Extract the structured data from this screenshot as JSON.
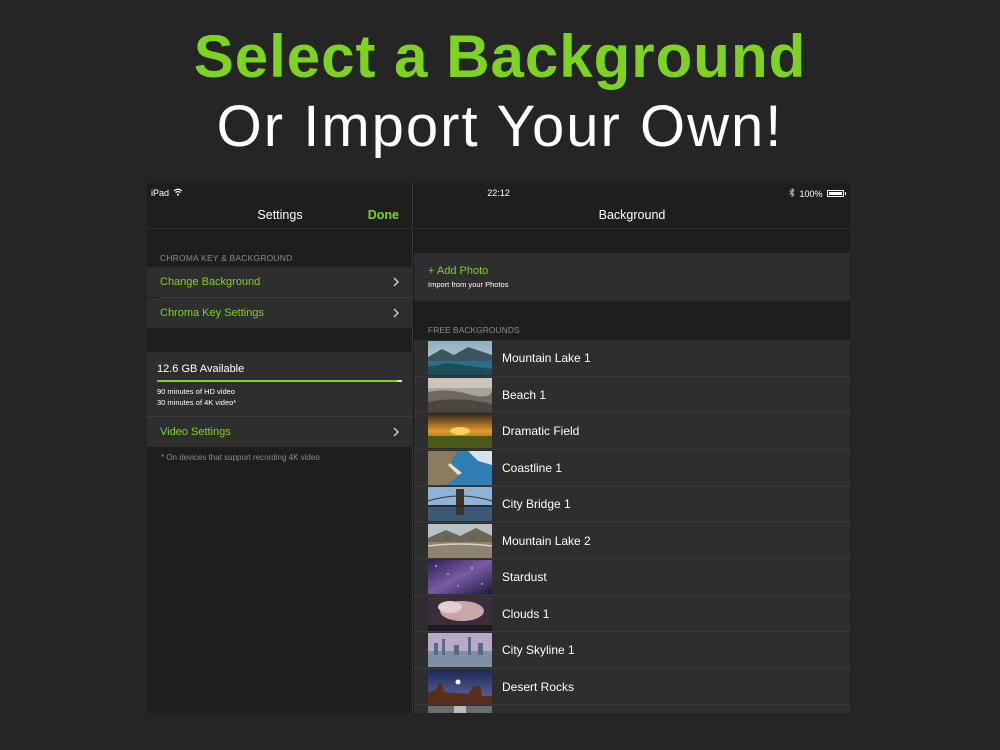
{
  "promo": {
    "headline": "Select a Background",
    "subheadline": "Or Import Your Own!"
  },
  "colors": {
    "accent": "#7ed321",
    "background": "#252525",
    "cell": "#2e2e2e"
  },
  "status_bar": {
    "device": "iPad",
    "wifi_icon": "wifi-icon",
    "time": "22:12",
    "bluetooth_icon": "bluetooth-icon",
    "battery": "100%"
  },
  "settings": {
    "title": "Settings",
    "done_label": "Done",
    "section_header": "CHROMA KEY & BACKGROUND",
    "change_background": "Change Background",
    "chroma_key_settings": "Chroma Key Settings",
    "storage": {
      "available": "12.6 GB Available",
      "used_fraction": 0.98,
      "hd_minutes": "90 minutes of HD video",
      "k4_minutes": "30 minutes of 4K video*"
    },
    "video_settings": "Video Settings",
    "footnote": "* On devices that support recording 4K video"
  },
  "background": {
    "title": "Background",
    "add_photo": "+ Add Photo",
    "add_photo_sub": "Import from your Photos",
    "section_header": "FREE BACKGROUNDS",
    "items": [
      {
        "name": "Mountain Lake 1",
        "thumb": "lake"
      },
      {
        "name": "Beach 1",
        "thumb": "beach"
      },
      {
        "name": "Dramatic Field",
        "thumb": "field"
      },
      {
        "name": "Coastline 1",
        "thumb": "coast"
      },
      {
        "name": "City Bridge 1",
        "thumb": "bridge"
      },
      {
        "name": "Mountain Lake 2",
        "thumb": "lake2"
      },
      {
        "name": "Stardust",
        "thumb": "stars"
      },
      {
        "name": "Clouds 1",
        "thumb": "clouds"
      },
      {
        "name": "City Skyline 1",
        "thumb": "skyline"
      },
      {
        "name": "Desert Rocks",
        "thumb": "desert"
      }
    ]
  }
}
